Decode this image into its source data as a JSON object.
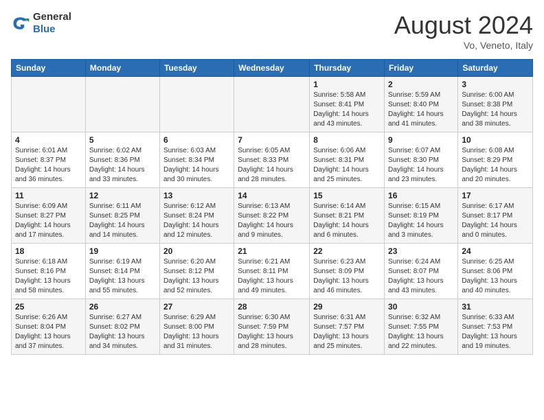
{
  "header": {
    "logo_line1": "General",
    "logo_line2": "Blue",
    "month_year": "August 2024",
    "location": "Vo, Veneto, Italy"
  },
  "days_of_week": [
    "Sunday",
    "Monday",
    "Tuesday",
    "Wednesday",
    "Thursday",
    "Friday",
    "Saturday"
  ],
  "weeks": [
    [
      {
        "day": "",
        "info": ""
      },
      {
        "day": "",
        "info": ""
      },
      {
        "day": "",
        "info": ""
      },
      {
        "day": "",
        "info": ""
      },
      {
        "day": "1",
        "info": "Sunrise: 5:58 AM\nSunset: 8:41 PM\nDaylight: 14 hours\nand 43 minutes."
      },
      {
        "day": "2",
        "info": "Sunrise: 5:59 AM\nSunset: 8:40 PM\nDaylight: 14 hours\nand 41 minutes."
      },
      {
        "day": "3",
        "info": "Sunrise: 6:00 AM\nSunset: 8:38 PM\nDaylight: 14 hours\nand 38 minutes."
      }
    ],
    [
      {
        "day": "4",
        "info": "Sunrise: 6:01 AM\nSunset: 8:37 PM\nDaylight: 14 hours\nand 36 minutes."
      },
      {
        "day": "5",
        "info": "Sunrise: 6:02 AM\nSunset: 8:36 PM\nDaylight: 14 hours\nand 33 minutes."
      },
      {
        "day": "6",
        "info": "Sunrise: 6:03 AM\nSunset: 8:34 PM\nDaylight: 14 hours\nand 30 minutes."
      },
      {
        "day": "7",
        "info": "Sunrise: 6:05 AM\nSunset: 8:33 PM\nDaylight: 14 hours\nand 28 minutes."
      },
      {
        "day": "8",
        "info": "Sunrise: 6:06 AM\nSunset: 8:31 PM\nDaylight: 14 hours\nand 25 minutes."
      },
      {
        "day": "9",
        "info": "Sunrise: 6:07 AM\nSunset: 8:30 PM\nDaylight: 14 hours\nand 23 minutes."
      },
      {
        "day": "10",
        "info": "Sunrise: 6:08 AM\nSunset: 8:29 PM\nDaylight: 14 hours\nand 20 minutes."
      }
    ],
    [
      {
        "day": "11",
        "info": "Sunrise: 6:09 AM\nSunset: 8:27 PM\nDaylight: 14 hours\nand 17 minutes."
      },
      {
        "day": "12",
        "info": "Sunrise: 6:11 AM\nSunset: 8:25 PM\nDaylight: 14 hours\nand 14 minutes."
      },
      {
        "day": "13",
        "info": "Sunrise: 6:12 AM\nSunset: 8:24 PM\nDaylight: 14 hours\nand 12 minutes."
      },
      {
        "day": "14",
        "info": "Sunrise: 6:13 AM\nSunset: 8:22 PM\nDaylight: 14 hours\nand 9 minutes."
      },
      {
        "day": "15",
        "info": "Sunrise: 6:14 AM\nSunset: 8:21 PM\nDaylight: 14 hours\nand 6 minutes."
      },
      {
        "day": "16",
        "info": "Sunrise: 6:15 AM\nSunset: 8:19 PM\nDaylight: 14 hours\nand 3 minutes."
      },
      {
        "day": "17",
        "info": "Sunrise: 6:17 AM\nSunset: 8:17 PM\nDaylight: 14 hours\nand 0 minutes."
      }
    ],
    [
      {
        "day": "18",
        "info": "Sunrise: 6:18 AM\nSunset: 8:16 PM\nDaylight: 13 hours\nand 58 minutes."
      },
      {
        "day": "19",
        "info": "Sunrise: 6:19 AM\nSunset: 8:14 PM\nDaylight: 13 hours\nand 55 minutes."
      },
      {
        "day": "20",
        "info": "Sunrise: 6:20 AM\nSunset: 8:12 PM\nDaylight: 13 hours\nand 52 minutes."
      },
      {
        "day": "21",
        "info": "Sunrise: 6:21 AM\nSunset: 8:11 PM\nDaylight: 13 hours\nand 49 minutes."
      },
      {
        "day": "22",
        "info": "Sunrise: 6:23 AM\nSunset: 8:09 PM\nDaylight: 13 hours\nand 46 minutes."
      },
      {
        "day": "23",
        "info": "Sunrise: 6:24 AM\nSunset: 8:07 PM\nDaylight: 13 hours\nand 43 minutes."
      },
      {
        "day": "24",
        "info": "Sunrise: 6:25 AM\nSunset: 8:06 PM\nDaylight: 13 hours\nand 40 minutes."
      }
    ],
    [
      {
        "day": "25",
        "info": "Sunrise: 6:26 AM\nSunset: 8:04 PM\nDaylight: 13 hours\nand 37 minutes."
      },
      {
        "day": "26",
        "info": "Sunrise: 6:27 AM\nSunset: 8:02 PM\nDaylight: 13 hours\nand 34 minutes."
      },
      {
        "day": "27",
        "info": "Sunrise: 6:29 AM\nSunset: 8:00 PM\nDaylight: 13 hours\nand 31 minutes."
      },
      {
        "day": "28",
        "info": "Sunrise: 6:30 AM\nSunset: 7:59 PM\nDaylight: 13 hours\nand 28 minutes."
      },
      {
        "day": "29",
        "info": "Sunrise: 6:31 AM\nSunset: 7:57 PM\nDaylight: 13 hours\nand 25 minutes."
      },
      {
        "day": "30",
        "info": "Sunrise: 6:32 AM\nSunset: 7:55 PM\nDaylight: 13 hours\nand 22 minutes."
      },
      {
        "day": "31",
        "info": "Sunrise: 6:33 AM\nSunset: 7:53 PM\nDaylight: 13 hours\nand 19 minutes."
      }
    ]
  ]
}
